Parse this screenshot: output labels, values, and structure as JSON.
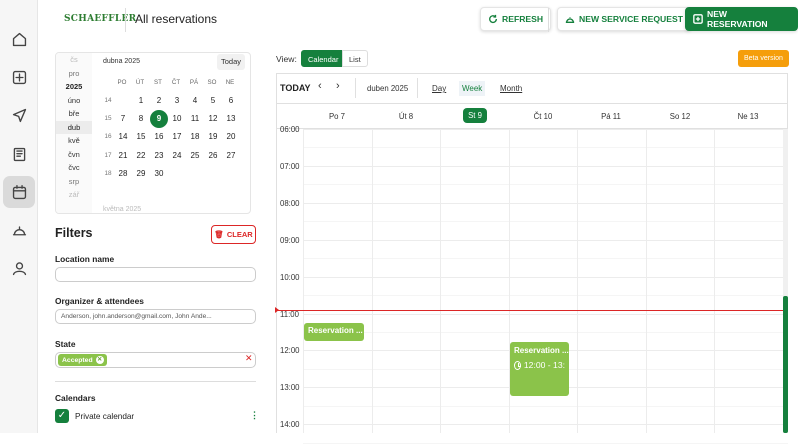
{
  "app": {
    "brand": "SCHAEFFLER",
    "page_title": "All reservations"
  },
  "toolbar": {
    "refresh": "REFRESH",
    "new_service_request": "NEW SERVICE REQUEST",
    "new_reservation": "NEW RESERVATION"
  },
  "nav": [
    "home-icon",
    "add-box-icon",
    "send-icon",
    "book-icon",
    "calendar-icon",
    "service-bell-icon",
    "person-icon"
  ],
  "mini_calendar": {
    "months": [
      "čs",
      "pro",
      "2025",
      "úno",
      "bře",
      "dub",
      "kvě",
      "čvn",
      "čvc",
      "srp",
      "zář"
    ],
    "title": "dubna 2025",
    "today": "Today",
    "day_headers": [
      "PO",
      "ÚT",
      "ST",
      "ČT",
      "PÁ",
      "SO",
      "NE"
    ],
    "weeks": [
      {
        "week": "14",
        "days": [
          "",
          "1",
          "2",
          "3",
          "4",
          "5",
          "6"
        ]
      },
      {
        "week": "15",
        "days": [
          "7",
          "8",
          "9",
          "10",
          "11",
          "12",
          "13"
        ]
      },
      {
        "week": "16",
        "days": [
          "14",
          "15",
          "16",
          "17",
          "18",
          "19",
          "20"
        ]
      },
      {
        "week": "17",
        "days": [
          "21",
          "22",
          "23",
          "24",
          "25",
          "26",
          "27"
        ]
      },
      {
        "week": "18",
        "days": [
          "28",
          "29",
          "30",
          "",
          "",
          "",
          ""
        ]
      }
    ],
    "selected_day": "9",
    "next_month": "května 2025"
  },
  "filters": {
    "title": "Filters",
    "clear": "CLEAR",
    "location_label": "Location name",
    "location_value": "",
    "organizer_label": "Organizer & attendees",
    "organizer_value": "Anderson, john.anderson@gmail.com,  John Ande...",
    "state_label": "State",
    "state_chip": "Accepted",
    "calendars_label": "Calendars",
    "private_calendar": "Private calendar"
  },
  "calendar": {
    "view_label": "View:",
    "view_options": [
      "Calendar",
      "List"
    ],
    "beta": "Beta version",
    "today": "TODAY",
    "month": "duben 2025",
    "tabs": [
      "Day",
      "Week",
      "Month"
    ],
    "active_tab": "Week",
    "days": [
      "Po 7",
      "Út 8",
      "St 9",
      "Čt 10",
      "Pá 11",
      "So 12",
      "Ne 13"
    ],
    "times": [
      "06:00",
      "07:00",
      "08:00",
      "09:00",
      "10:00",
      "11:00",
      "12:00",
      "13:00",
      "14:00"
    ],
    "events": [
      {
        "title": "Reservation ...",
        "time": ""
      },
      {
        "title": "Reservation ...",
        "time": "12:00 - 13:"
      }
    ]
  },
  "colors": {
    "primary": "#15803d",
    "event": "#8bc34a",
    "danger": "#dc2626",
    "beta": "#f59e0b"
  }
}
